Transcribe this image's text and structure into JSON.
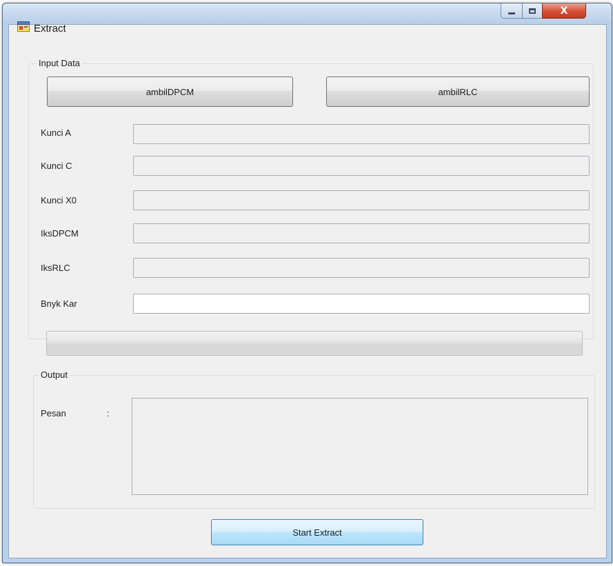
{
  "window": {
    "title": "Extract",
    "close_glyph": "X"
  },
  "input_group": {
    "label": "Input Data",
    "buttons": {
      "dpcm": "ambilDPCM",
      "rlc": "ambilRLC"
    },
    "fields": [
      {
        "label": "Kunci A",
        "value": ""
      },
      {
        "label": "Kunci C",
        "value": ""
      },
      {
        "label": "Kunci X0",
        "value": ""
      },
      {
        "label": "IksDPCM",
        "value": ""
      },
      {
        "label": "IksRLC",
        "value": ""
      },
      {
        "label": "Bnyk Kar",
        "value": ""
      }
    ]
  },
  "progress": {
    "value": 0
  },
  "output_group": {
    "label": "Output",
    "pesan_label": "Pesan",
    "pesan_colon": ":",
    "pesan_value": ""
  },
  "actions": {
    "start_label": "Start Extract"
  },
  "colors": {
    "titlebar": "#c6d9ee",
    "close": "#c3371f",
    "client": "#f0f0f0"
  },
  "icons": {
    "app": "app-form-icon",
    "minimize": "minimize-icon",
    "maximize": "maximize-icon",
    "close": "close-icon"
  }
}
